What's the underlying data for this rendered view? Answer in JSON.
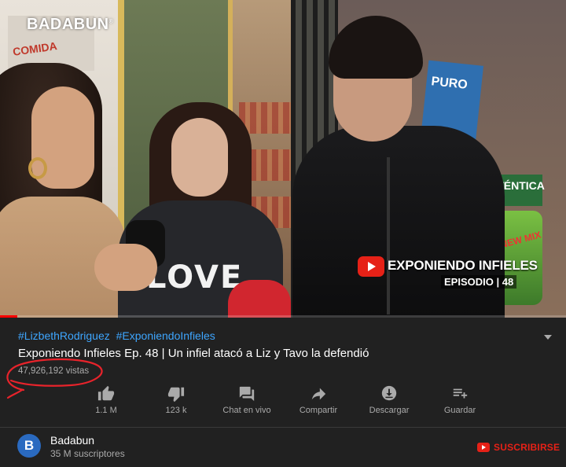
{
  "video": {
    "brand_logo": "BADABUN",
    "overlay_title": "EXPONIENDO INFIELES",
    "overlay_episode": "EPISODIO | 48",
    "scene_text": {
      "shop_sign": "COMIDA",
      "poster": "PURO",
      "autentica": "AUTÉNTICA",
      "bottle": "NEW MIX",
      "shirt": "LOVE"
    },
    "progress_fraction": 0.03
  },
  "info": {
    "hashtags": [
      "#LizbethRodriguez",
      "#ExponiendoInfieles"
    ],
    "title": "Exponiendo Infieles Ep. 48 | Un infiel atacó a Liz y Tavo la defendió",
    "views": "47,926,192 vistas"
  },
  "actions": [
    {
      "name": "like",
      "icon": "thumbs-up-icon",
      "label": "1.1 M"
    },
    {
      "name": "dislike",
      "icon": "thumbs-down-icon",
      "label": "123 k"
    },
    {
      "name": "live-chat",
      "icon": "chat-icon",
      "label": "Chat en vivo"
    },
    {
      "name": "share",
      "icon": "share-icon",
      "label": "Compartir"
    },
    {
      "name": "download",
      "icon": "download-icon",
      "label": "Descargar"
    },
    {
      "name": "save",
      "icon": "playlist-add-icon",
      "label": "Guardar"
    }
  ],
  "channel": {
    "avatar_letter": "B",
    "name": "Badabun",
    "subscribers": "35 M suscriptores",
    "subscribe_label": "SUSCRIBIRSE"
  },
  "colors": {
    "background": "#212121",
    "link": "#3ea6ff",
    "secondary_text": "#aaaaaa",
    "youtube_red": "#e62117",
    "annotation_red": "#e8232b"
  }
}
